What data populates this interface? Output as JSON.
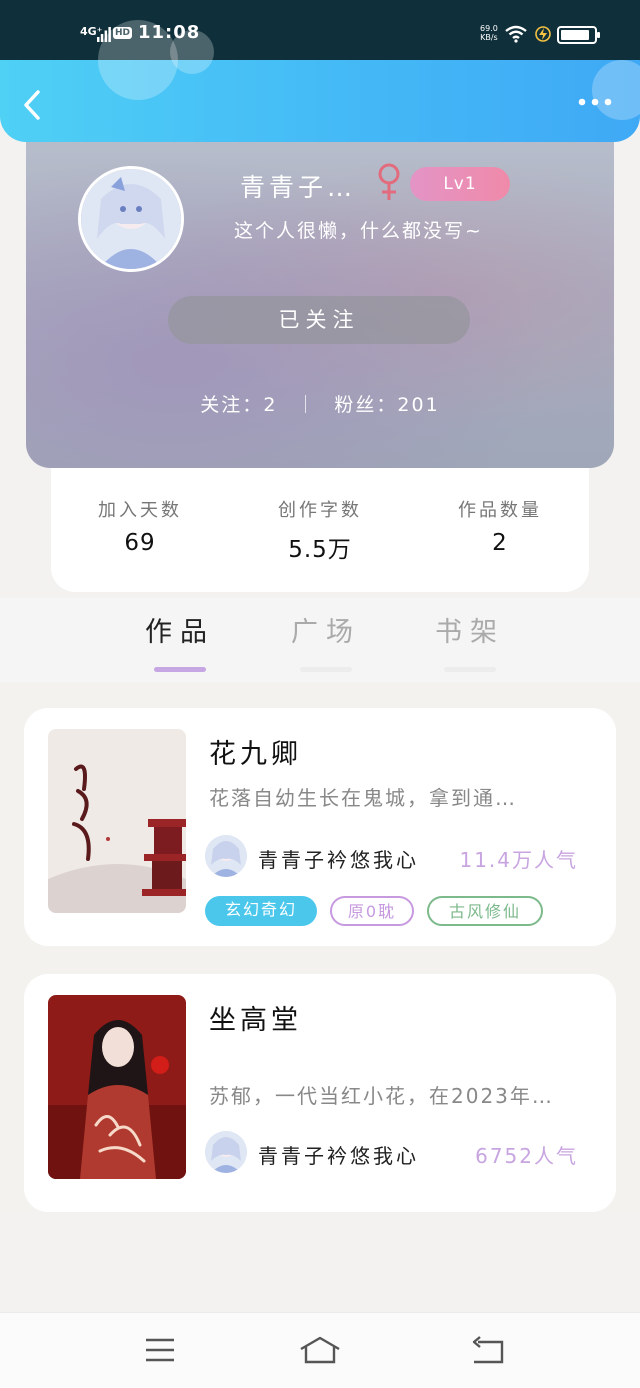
{
  "status": {
    "network": "4G⁺",
    "hd": "HD",
    "time": "11:08",
    "speed_value": "69.0",
    "speed_unit": "KB/s"
  },
  "header": {
    "back_icon": "chevron-left-icon",
    "more_icon": "more-dots-icon"
  },
  "profile": {
    "username": "青青子…",
    "gender_icon": "female-icon",
    "gender_color": "#e26b7d",
    "level": "Lv1",
    "bio": "这个人很懒，什么都没写~",
    "follow_button": "已关注",
    "following_label": "关注：",
    "following": "2",
    "fans_label": "粉丝：",
    "fans": "201"
  },
  "info": [
    {
      "label": "加入天数",
      "value": "69"
    },
    {
      "label": "创作字数",
      "value": "5.5万"
    },
    {
      "label": "作品数量",
      "value": "2"
    }
  ],
  "tabs": [
    {
      "label": "作品",
      "active": true
    },
    {
      "label": "广场",
      "active": false
    },
    {
      "label": "书架",
      "active": false
    }
  ],
  "books": [
    {
      "title": "花九卿",
      "desc": "花落自幼生长在鬼城，拿到通…",
      "author": "青青子衿悠我心",
      "popularity": "11.4万人气",
      "tags": [
        {
          "label": "玄幻奇幻",
          "color": "#4cc7ec"
        },
        {
          "label": "原0耽",
          "color": "#c79ae0"
        },
        {
          "label": "古风修仙",
          "color": "#7cb98b"
        }
      ]
    },
    {
      "title": "坐高堂",
      "desc": "苏郁，一代当红小花，在2023年…",
      "author": "青青子衿悠我心",
      "popularity": "6752人气",
      "tags": []
    }
  ],
  "accent_colors": {
    "topbar": "#44b9f6",
    "tab_underline": "#c7a7e3",
    "popularity": "#c8a5e0"
  },
  "nav": {
    "menu_icon": "menu-icon",
    "home_icon": "home-icon",
    "back_icon": "return-icon"
  }
}
